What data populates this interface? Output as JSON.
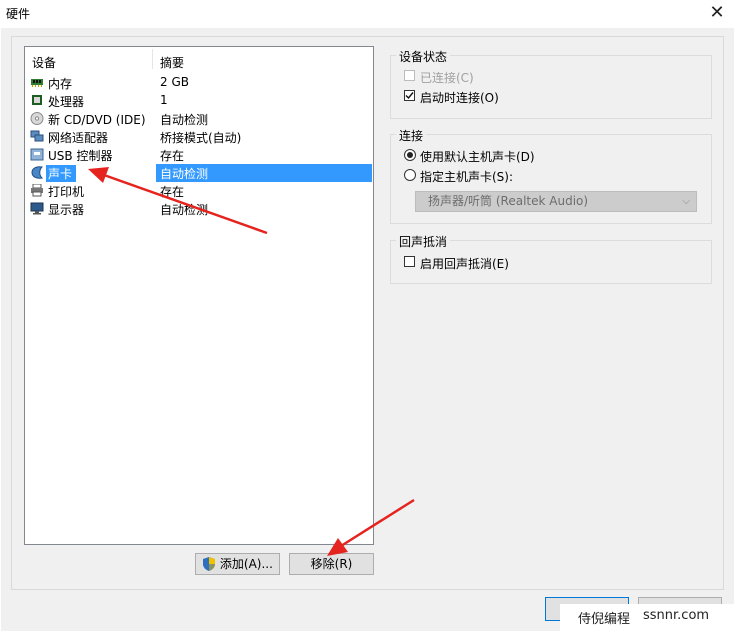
{
  "window": {
    "title": "硬件"
  },
  "device_list": {
    "headers": {
      "device": "设备",
      "summary": "摘要"
    },
    "rows": [
      {
        "name": "内存",
        "summary": "2 GB",
        "icon": "memory-icon"
      },
      {
        "name": "处理器",
        "summary": "1",
        "icon": "processor-icon"
      },
      {
        "name": "新 CD/DVD (IDE)",
        "summary": "自动检测",
        "icon": "cd-dvd-icon"
      },
      {
        "name": "网络适配器",
        "summary": "桥接模式(自动)",
        "icon": "network-adapter-icon"
      },
      {
        "name": "USB 控制器",
        "summary": "存在",
        "icon": "usb-icon"
      },
      {
        "name": "声卡",
        "summary": "自动检测",
        "icon": "sound-card-icon",
        "selected": true
      },
      {
        "name": "打印机",
        "summary": "存在",
        "icon": "printer-icon"
      },
      {
        "name": "显示器",
        "summary": "自动检测",
        "icon": "display-icon"
      }
    ],
    "add_button": "添加(A)...",
    "remove_button": "移除(R)"
  },
  "device_status": {
    "label": "设备状态",
    "connected": {
      "label": "已连接(C)",
      "checked": false,
      "disabled": true
    },
    "connect_at_power_on": {
      "label": "启动时连接(O)",
      "checked": true
    }
  },
  "connection": {
    "label": "连接",
    "use_default": {
      "label": "使用默认主机声卡(D)",
      "selected": true
    },
    "specify": {
      "label": "指定主机声卡(S):",
      "selected": false
    },
    "host_card_select": {
      "value": "扬声器/听筒 (Realtek Audio)",
      "disabled": true
    }
  },
  "echo_cancel": {
    "label": "回声抵消",
    "enable": {
      "label": "启用回声抵消(E)",
      "checked": false
    }
  },
  "watermark": {
    "brand": "侍倪编程",
    "domain": "ssnnr.com"
  },
  "colors": {
    "selection": "#3399ff",
    "arrow": "#e52420",
    "accent": "#0078d7"
  }
}
